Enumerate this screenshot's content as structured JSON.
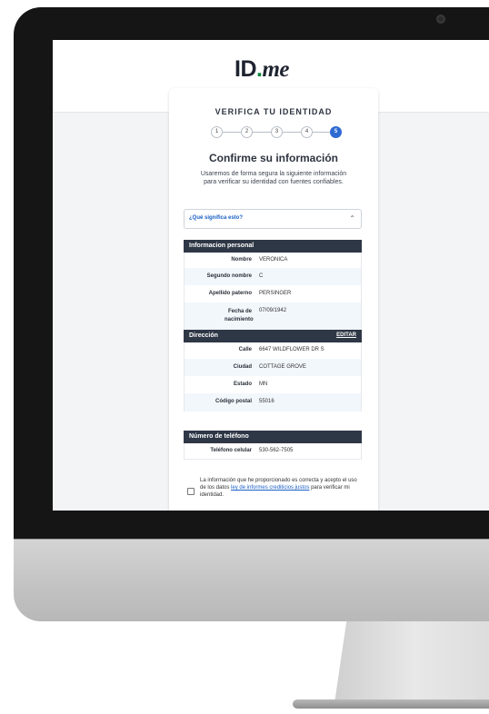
{
  "brand": {
    "logo_id": "ID",
    "logo_dot": ".",
    "logo_me": "me"
  },
  "card": {
    "title": "VERIFICA TU IDENTIDAD",
    "steps": [
      "1",
      "2",
      "3",
      "4",
      "5"
    ],
    "active_step": 5,
    "heading": "Confirme su información",
    "subtext": "Usaremos de forma segura la siguiente información para verificar su identidad con fuentes confiables."
  },
  "accordion": {
    "label": "¿Qué significa esto?"
  },
  "personal": {
    "header": "Informacion personal",
    "rows": [
      {
        "label": "Nombre",
        "value": "VERONICA"
      },
      {
        "label": "Segundo nombre",
        "value": "C"
      },
      {
        "label": "Apellido paterno",
        "value": "PERSINGER"
      },
      {
        "label": "Fecha de nacimiento",
        "value": "07/09/1942"
      }
    ]
  },
  "address": {
    "header": "Dirección",
    "edit_label": "EDITAR",
    "rows": [
      {
        "label": "Calle",
        "value": "6647 WILDFLOWER DR S"
      },
      {
        "label": "Ciudad",
        "value": "COTTAGE GROVE"
      },
      {
        "label": "Estado",
        "value": "MN"
      },
      {
        "label": "Código postal",
        "value": "55016"
      }
    ]
  },
  "phone": {
    "header": "Número de teléfono",
    "rows": [
      {
        "label": "Teléfono celular",
        "value": "530-562-7505"
      }
    ]
  },
  "consent": {
    "text_before": "La información que he proporcionado es correcta y acepto el uso de los datos ",
    "link1": "ley de informes crediticios justos",
    "text_after": " para verificar mi identidad."
  }
}
